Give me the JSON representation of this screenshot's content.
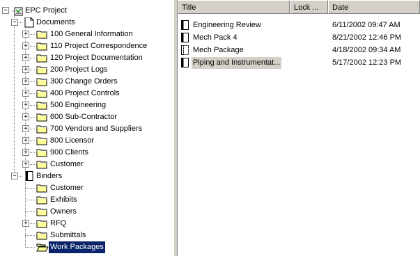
{
  "tree": {
    "project": {
      "label": "EPC Project",
      "expander": "−"
    },
    "documents": {
      "label": "Documents",
      "expander": "−",
      "folders": [
        {
          "label": "100 General Information",
          "expander": "+"
        },
        {
          "label": "110 Project Correspondence",
          "expander": "+"
        },
        {
          "label": "120 Project Documentation",
          "expander": "+"
        },
        {
          "label": "200 Project Logs",
          "expander": "+"
        },
        {
          "label": "300 Change Orders",
          "expander": "+"
        },
        {
          "label": "400 Project Controls",
          "expander": "+"
        },
        {
          "label": "500 Engineering",
          "expander": "+"
        },
        {
          "label": "600 Sub-Contractor",
          "expander": "+"
        },
        {
          "label": "700 Vendors and Suppliers",
          "expander": "+"
        },
        {
          "label": "800 Licensor",
          "expander": "+"
        },
        {
          "label": "900 Clients",
          "expander": "+"
        },
        {
          "label": "Customer",
          "expander": "+"
        }
      ]
    },
    "binders": {
      "label": "Binders",
      "expander": "−",
      "folders": [
        {
          "label": "Customer",
          "expander": ""
        },
        {
          "label": "Exhibits",
          "expander": ""
        },
        {
          "label": "Owners",
          "expander": ""
        },
        {
          "label": "RFQ",
          "expander": "+"
        },
        {
          "label": "Submittals",
          "expander": ""
        },
        {
          "label": "Work Packages",
          "expander": "",
          "selected": true
        }
      ]
    }
  },
  "list": {
    "columns": {
      "title": "Title",
      "lock": "Lock ...",
      "date": "Date"
    },
    "rows": [
      {
        "title": "Engineering Review",
        "date": "6/11/2002 09:47 AM",
        "icon": "binder-icon"
      },
      {
        "title": "Mech Pack 4",
        "date": "8/21/2002 12:46 PM",
        "icon": "binder-icon"
      },
      {
        "title": "Mech Package",
        "date": "4/18/2002 09:34 AM",
        "icon": "binder-outline-icon"
      },
      {
        "title": "Piping and Instrumentat...",
        "date": "5/17/2002 12:23 PM",
        "icon": "binder-icon",
        "selected": true
      }
    ]
  },
  "colors": {
    "selection": "#0a246a",
    "folder": "#ffff99",
    "chrome": "#d4d0c8"
  }
}
